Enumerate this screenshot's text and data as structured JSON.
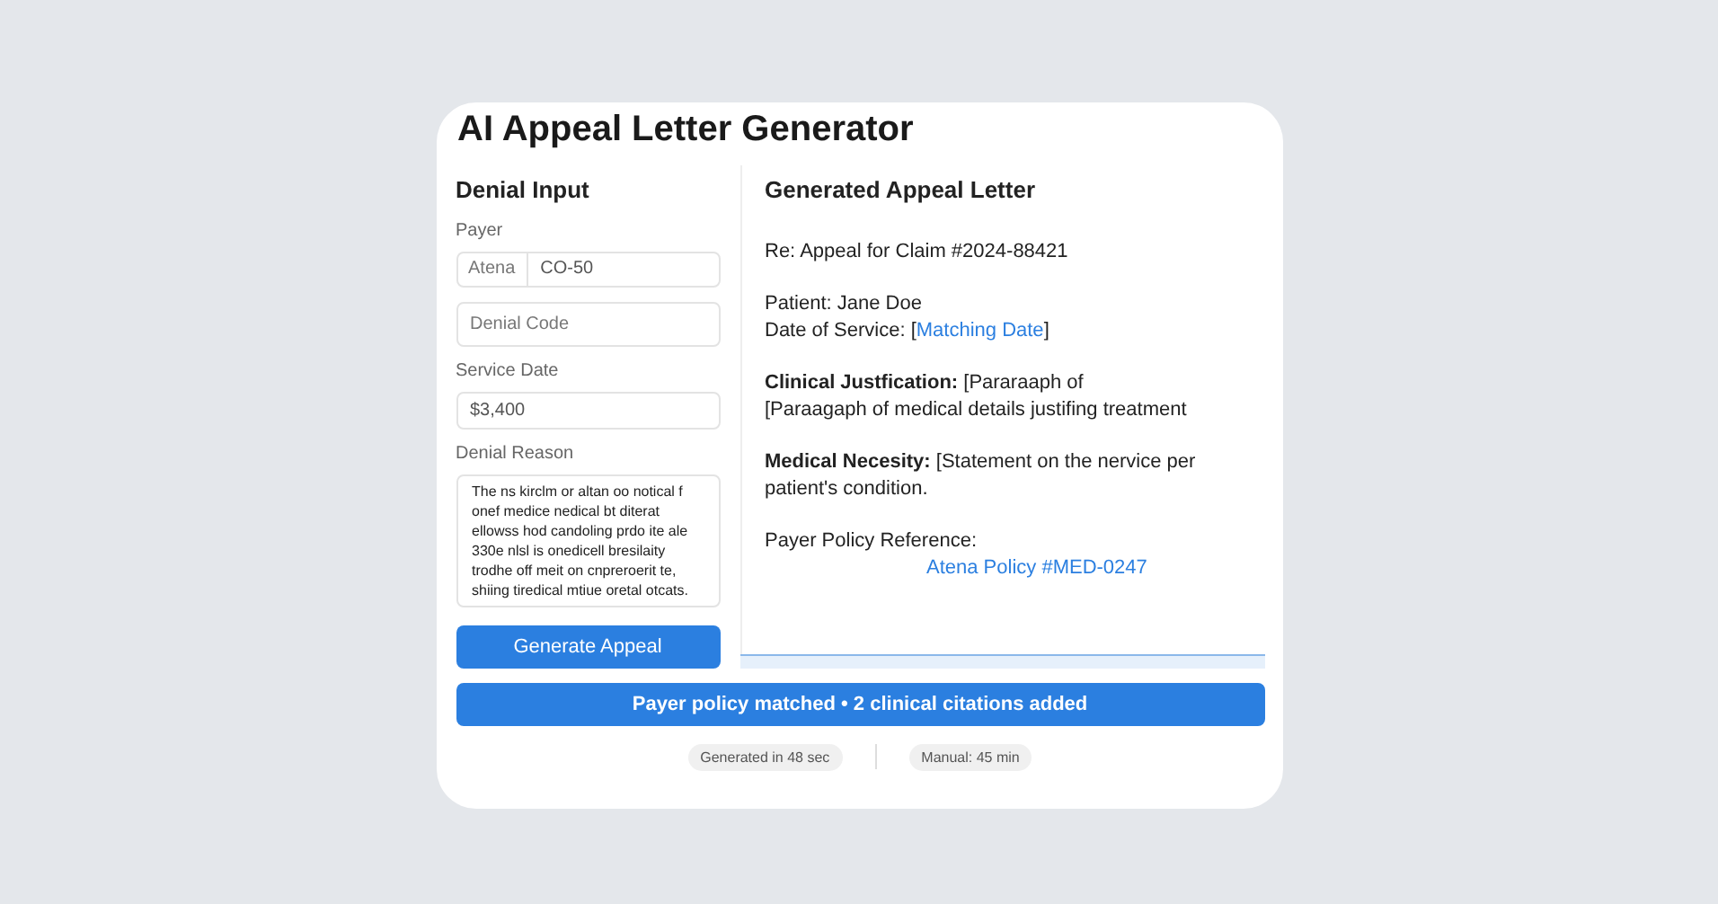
{
  "title": "AI Appeal Letter Generator",
  "input": {
    "heading": "Denial Input",
    "payer": {
      "label": "Payer",
      "prefix": "Atena",
      "value": "CO-50"
    },
    "denial_code": {
      "placeholder": "Denial Code"
    },
    "service_date": {
      "label": "Service Date",
      "value": "$3,400"
    },
    "denial_reason": {
      "label": "Denial Reason",
      "value": "The ns kirclm or altan oo notical f onef medice nedical bt diterat ellowss hod candoling prdo ite ale 330e nlsl is onedicell bresilaity trodhe off meit on cnpreroerit te, shiing tiredical mtiue oretal otcats."
    },
    "button": "Generate Appeal"
  },
  "letter": {
    "heading": "Generated Appeal Letter",
    "paragraphs": [
      {
        "lines": [
          "Re: Appeal for Claim #2024-88421"
        ]
      },
      {
        "lines": [
          "Patient: Jane Doe",
          {
            "text": "Date of Service: [",
            "link": "Matching Date",
            "tail": "]"
          }
        ]
      },
      {
        "lines": [
          "**Clinical Justfication:** [Pararaaph of",
          "[Paraagaph of medical details justifing treatment"
        ]
      },
      {
        "lines": [
          "**Medical Necesity:** [Statement on the nervice per",
          "patient's condition."
        ]
      },
      {
        "lines": [
          "Payer Policy Reference:"
        ],
        "link": "Atena Policy #MED-0247"
      }
    ]
  },
  "status": "Payer policy matched • 2 clinical citations added",
  "chips": [
    "Generated in 48 sec",
    "Manual: 45 min"
  ]
}
